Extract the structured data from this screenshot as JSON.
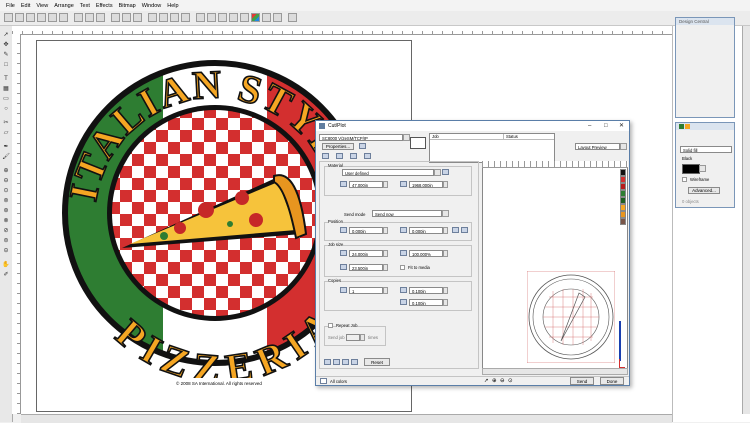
{
  "menu": [
    "File",
    "Edit",
    "View",
    "Arrange",
    "Text",
    "Effects",
    "Bitmap",
    "Window",
    "Help"
  ],
  "logo": {
    "top_text": "ITALIAN STYLE",
    "bottom_text": "PIZZERIA",
    "copyright": "© 2008 SA International. All rights reserved",
    "colors": {
      "green": "#2e7d32",
      "red": "#d32f2f",
      "gold": "#f5a623",
      "black": "#111111"
    }
  },
  "right_panels": {
    "panel1": {
      "title": "Design Central"
    },
    "panel2": {
      "fill_type": "Solid fill",
      "color_name": "Black",
      "wireframe_label": "Wireframe",
      "advanced_label": "Advanced...",
      "objects_label": "0 objects"
    }
  },
  "dialog": {
    "title": "Cut/Plot",
    "device": "SC8000 V/2eSM/TCP/IP",
    "properties_label": "Properties...",
    "job_header": "Job",
    "status_header": "Status",
    "preview_mode": "Layout Preview",
    "material_label": "Material",
    "material_value": "User defined",
    "material_width": "47.000in",
    "material_length": "1968.000in",
    "send_mode_label": "Send mode",
    "send_mode_value": "Send now",
    "position_label": "Position",
    "pos_x": "0.000in",
    "pos_y": "0.000in",
    "job_size_label": "Job size",
    "size_w": "24.000in",
    "size_pct": "100.000%",
    "size_h": "23.500in",
    "fit_to_media": "Fit to media",
    "copies_label": "Copies",
    "copies_value": "1",
    "gap_x": "0.100in",
    "gap_y": "0.100in",
    "repeat_job": "Repeat Job",
    "send_job_label": "Send job",
    "times_label": "times",
    "reset_label": "Reset",
    "all_colors": "All colors",
    "send_button": "Send",
    "done_button": "Done"
  }
}
